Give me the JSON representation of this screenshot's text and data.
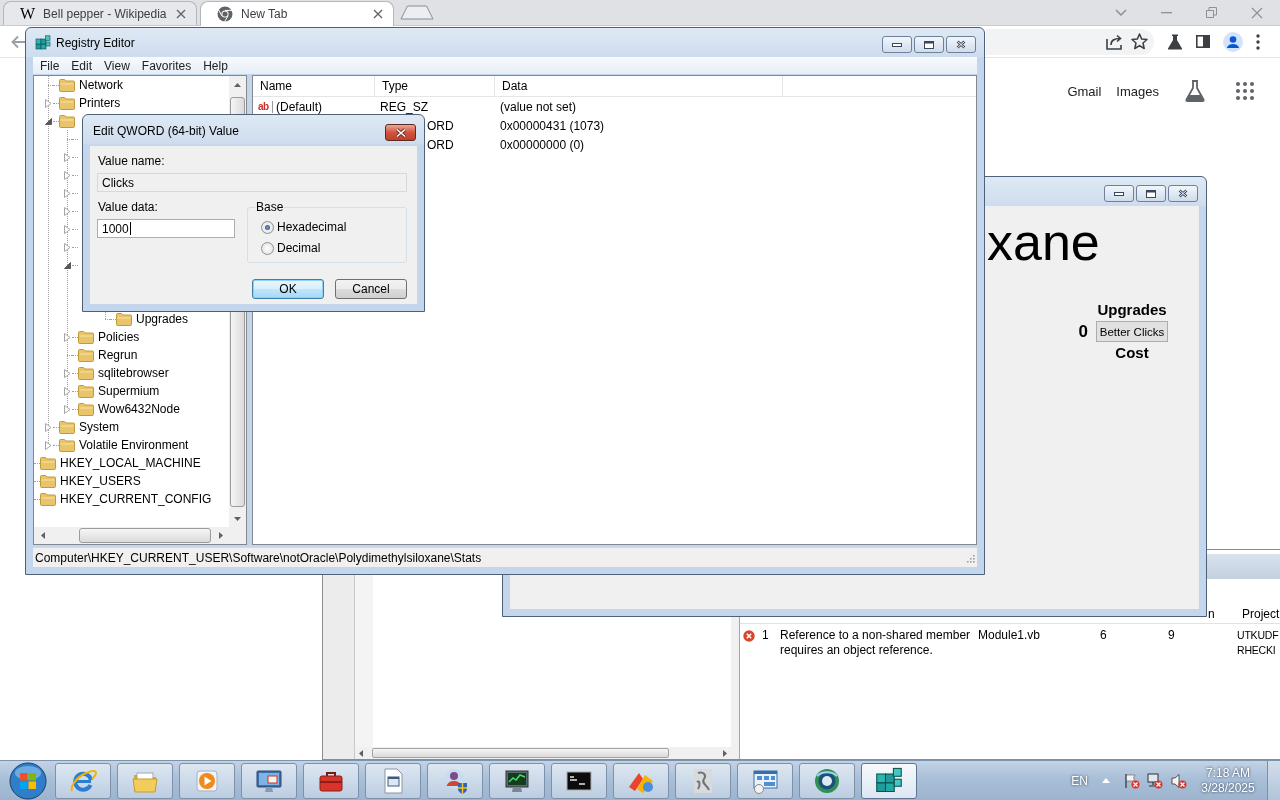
{
  "browser": {
    "tabs": [
      {
        "favicon": "W",
        "title": "Bell pepper - Wikipedia",
        "selected": false
      },
      {
        "title": "New Tab",
        "selected": true
      }
    ],
    "links": [
      "Gmail",
      "Images"
    ]
  },
  "ide": {
    "error_list": {
      "columns": [
        "n",
        "Project"
      ],
      "rows": [
        {
          "number": "1",
          "description": "Reference to a non-shared member requires an object reference.",
          "file": "Module1.vb",
          "line": "6",
          "column": "9",
          "project": [
            "UTKUDF",
            "RHECKI"
          ]
        }
      ]
    }
  },
  "game": {
    "heading": "xane",
    "upgrades": {
      "title": "Upgrades",
      "count": "0",
      "button": "Better Clicks",
      "footer": "Cost"
    }
  },
  "registry": {
    "title": "Registry Editor",
    "menu": [
      "File",
      "Edit",
      "View",
      "Favorites",
      "Help"
    ],
    "tree": [
      {
        "kind": "covered",
        "children": [
          {
            "kind": "key",
            "label": "Network"
          },
          {
            "kind": "key",
            "label": "Printers",
            "expanded": false
          },
          {
            "kind": "key",
            "expanded": true,
            "children": [
              {
                "kind": "covered"
              },
              {
                "kind": "covered",
                "expanded": false
              },
              {
                "kind": "covered",
                "expanded": false
              },
              {
                "kind": "covered",
                "expanded": false
              },
              {
                "kind": "covered",
                "expanded": false
              },
              {
                "kind": "covered",
                "expanded": false
              },
              {
                "kind": "covered",
                "expanded": false
              },
              {
                "kind": "covered",
                "expanded": true,
                "children": [
                  {
                    "kind": "covered",
                    "children": [
                      {
                        "kind": "covered"
                      },
                      {
                        "kind": "key",
                        "label": "Upgrades"
                      }
                    ]
                  }
                ]
              },
              {
                "kind": "key",
                "label": "Policies",
                "expanded": false
              },
              {
                "kind": "key",
                "label": "Regrun"
              },
              {
                "kind": "key",
                "label": "sqlitebrowser",
                "expanded": false
              },
              {
                "kind": "key",
                "label": "Supermium",
                "expanded": false
              },
              {
                "kind": "key",
                "label": "Wow6432Node",
                "expanded": false
              }
            ]
          },
          {
            "kind": "key",
            "label": "System",
            "expanded": false
          },
          {
            "kind": "key",
            "label": "Volatile Environment",
            "expanded": false
          }
        ]
      },
      {
        "kind": "key",
        "label": "HKEY_LOCAL_MACHINE"
      },
      {
        "kind": "key",
        "label": "HKEY_USERS"
      },
      {
        "kind": "key",
        "label": "HKEY_CURRENT_CONFIG"
      }
    ],
    "columns": [
      "Name",
      "Type",
      "Data"
    ],
    "values": [
      {
        "icon": "ab",
        "name": "(Default)",
        "type": "REG_SZ",
        "data": "(value not set)"
      },
      {
        "type": "ORD",
        "data": "0x00000431 (1073)"
      },
      {
        "type": "ORD",
        "data": "0x00000000 (0)"
      }
    ],
    "status": "Computer\\HKEY_CURRENT_USER\\Software\\notOracle\\Polydimethylsiloxane\\Stats"
  },
  "dialog": {
    "title": "Edit QWORD (64-bit) Value",
    "name_label": "Value name:",
    "name_value": "Clicks",
    "data_label": "Value data:",
    "data_value": "1000",
    "base": {
      "title": "Base",
      "options": [
        {
          "label": "Hexadecimal",
          "selected": true
        },
        {
          "label": "Decimal",
          "selected": false
        }
      ]
    },
    "buttons": [
      {
        "label": "OK",
        "focused": true
      },
      {
        "label": "Cancel",
        "focused": false
      }
    ]
  },
  "taskbar": {
    "buttons": [
      {
        "kind": "browser",
        "selected": false
      },
      {
        "kind": "folder",
        "selected": false
      },
      {
        "kind": "player",
        "selected": false
      },
      {
        "kind": "monitor",
        "selected": false
      },
      {
        "kind": "toolbox",
        "selected": false
      },
      {
        "kind": "document",
        "selected": false
      },
      {
        "kind": "avatar",
        "selected": false
      },
      {
        "kind": "screen",
        "selected": false
      },
      {
        "kind": "console",
        "selected": false
      },
      {
        "kind": "blocks",
        "selected": false
      },
      {
        "kind": "sketch",
        "selected": false
      },
      {
        "kind": "panel",
        "selected": false
      },
      {
        "kind": "globe",
        "selected": false
      },
      {
        "kind": "cubes",
        "selected": true
      }
    ],
    "language": "EN",
    "time": "7:18 AM",
    "date": "3/28/2025"
  }
}
